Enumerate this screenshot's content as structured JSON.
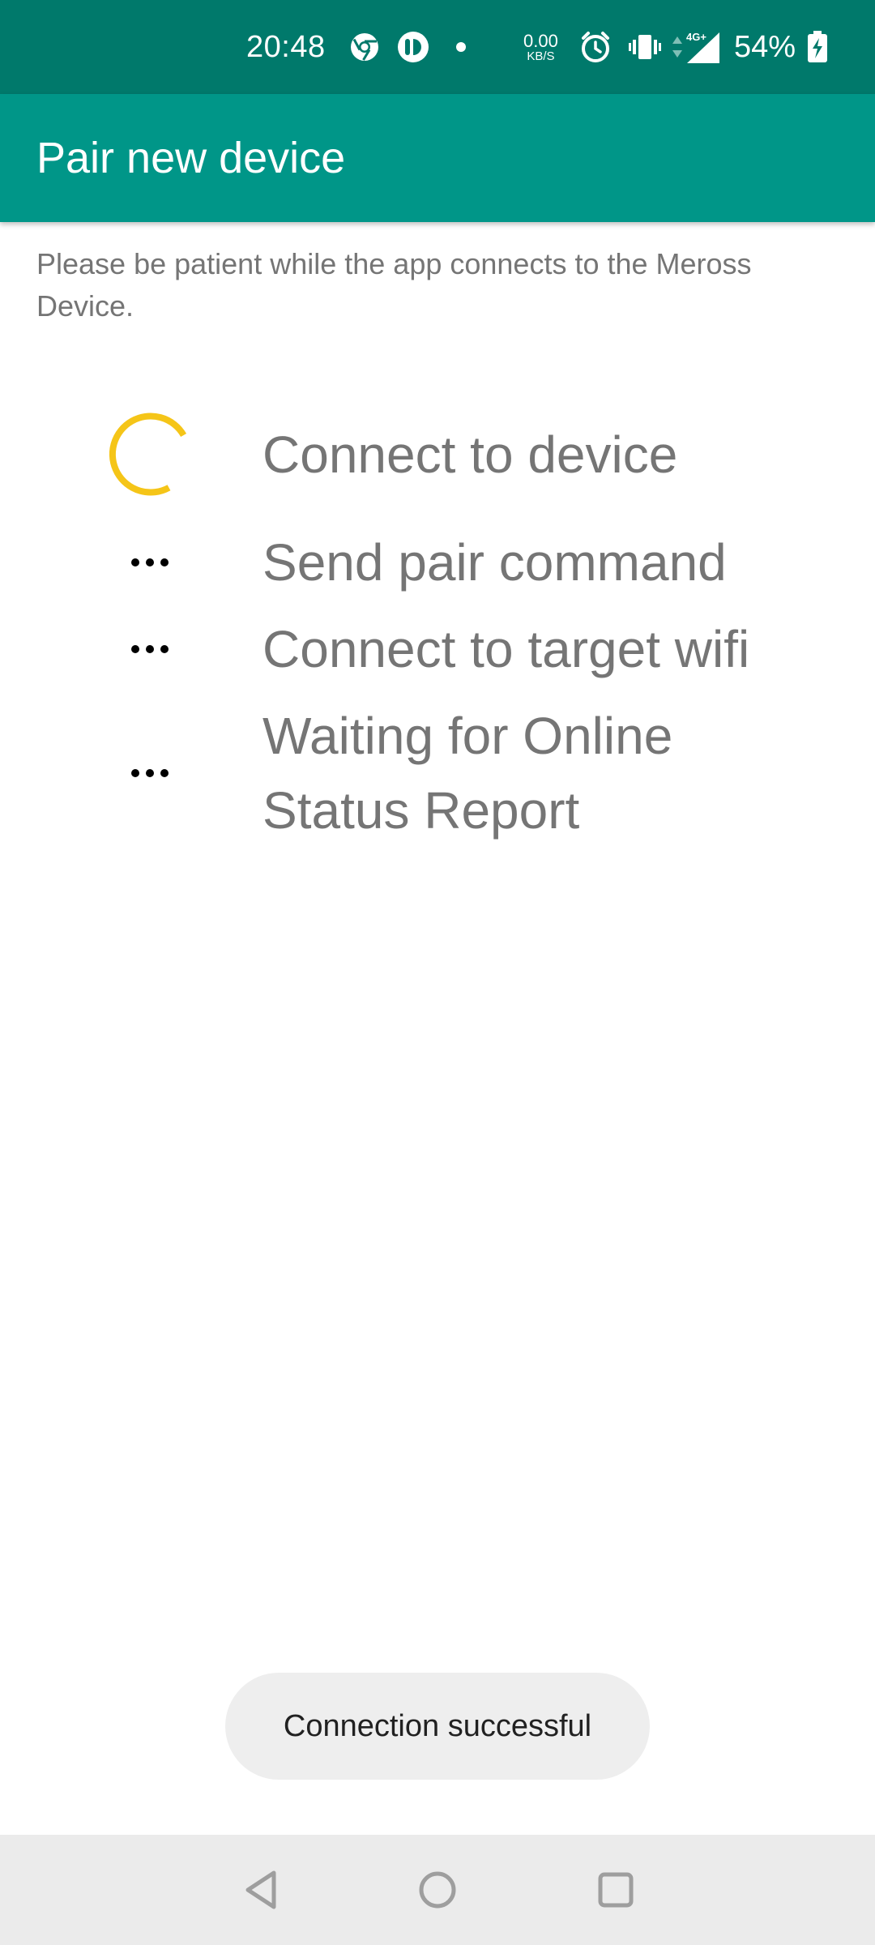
{
  "status_bar": {
    "time": "20:48",
    "icons": [
      "chrome-icon",
      "app-notification-icon",
      "dot-icon",
      "alarm-icon",
      "vibrate-icon",
      "data-arrows-icon",
      "signal-4g-icon",
      "battery-charging-icon"
    ],
    "network_speed_value": "0.00",
    "network_speed_unit": "KB/S",
    "network_type": "4G+",
    "battery_percent": "54%"
  },
  "app_bar": {
    "title": "Pair new device"
  },
  "description": "Please be patient while the app connects to the Meross Device.",
  "steps": [
    {
      "label": "Connect to device",
      "state": "in-progress",
      "icon": "spinner-icon"
    },
    {
      "label": "Send pair command",
      "state": "pending",
      "icon": "ellipsis-icon"
    },
    {
      "label": "Connect to target wifi",
      "state": "pending",
      "icon": "ellipsis-icon"
    },
    {
      "label": "Waiting for Online Status Report",
      "state": "pending",
      "icon": "ellipsis-icon"
    }
  ],
  "toast": {
    "message": "Connection successful"
  },
  "nav_bar": {
    "buttons": [
      "back-icon",
      "home-icon",
      "recents-icon"
    ]
  },
  "colors": {
    "status_bar": "#00796b",
    "app_bar": "#009688",
    "spinner": "#f5c518",
    "text_secondary": "#757575",
    "toast_bg": "#eeeeee",
    "nav_bar_bg": "#ebebeb"
  }
}
